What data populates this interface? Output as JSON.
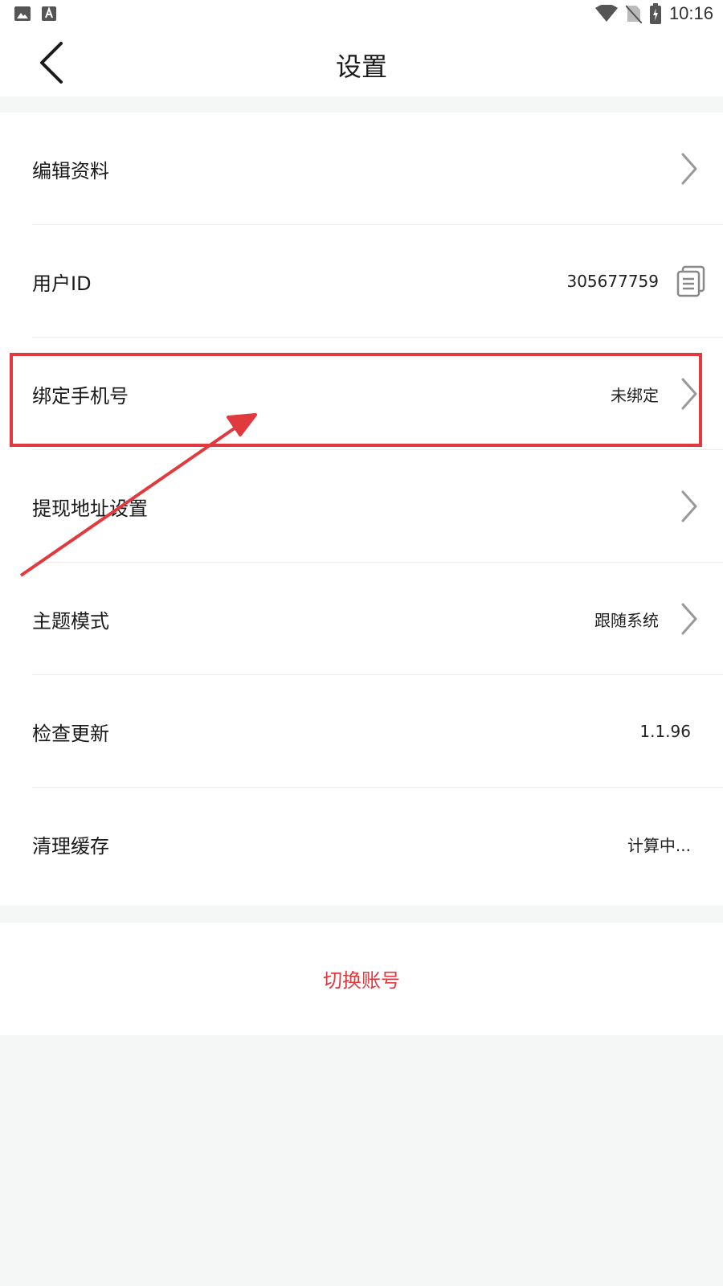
{
  "status_bar": {
    "time": "10:16",
    "left_icons": [
      "image-icon",
      "text-a-icon"
    ],
    "right_icons": [
      "wifi-icon",
      "no-sim-icon",
      "battery-charging-icon"
    ]
  },
  "nav": {
    "title": "设置",
    "back_icon": "chevron-left-icon"
  },
  "settings": {
    "edit_profile": {
      "label": "编辑资料"
    },
    "user_id": {
      "label": "用户ID",
      "value": "305677759",
      "icon": "copy-icon"
    },
    "bind_phone": {
      "label": "绑定手机号",
      "value": "未绑定"
    },
    "withdraw_address": {
      "label": "提现地址设置"
    },
    "theme_mode": {
      "label": "主题模式",
      "value": "跟随系统"
    },
    "check_update": {
      "label": "检查更新",
      "value": "1.1.96"
    },
    "clear_cache": {
      "label": "清理缓存",
      "value": "计算中..."
    }
  },
  "switch_account": {
    "label": "切换账号"
  },
  "colors": {
    "accent": "#e0393e",
    "page_background": "#f5f6f6",
    "card_background": "#ffffff"
  }
}
